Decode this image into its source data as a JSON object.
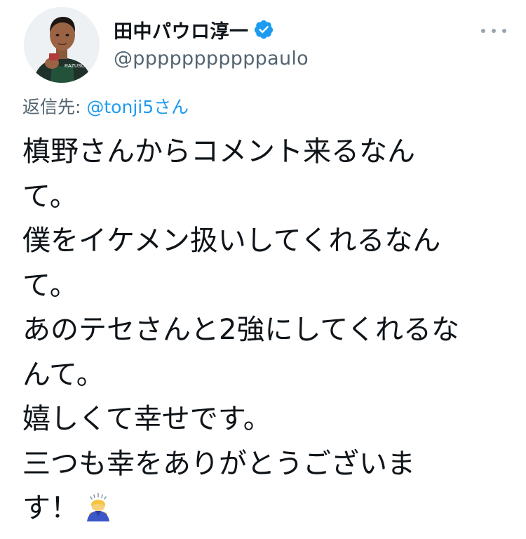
{
  "author": {
    "display_name": "田中パウロ淳一",
    "handle": "@pppppppppppaulo",
    "verified": true,
    "avatar_jersey_text": "RAZUSO"
  },
  "menu": {
    "icon": "more-horizontal-icon"
  },
  "reply": {
    "prefix": "返信先: ",
    "mention": "@tonji5さん"
  },
  "tweet": {
    "lines": [
      "槙野さんからコメント来るなん",
      "て。",
      "僕をイケメン扱いしてくれるなん",
      "て。",
      "あのテセさんと2強にしてくれるな",
      "んて。",
      "嬉しくて幸せです。",
      "三つも幸をありがとうございま",
      "す！"
    ],
    "emoji": "person-bowing-emoji"
  },
  "colors": {
    "text": "#0f1419",
    "secondary": "#536471",
    "link": "#1d9bf0",
    "verified": "#1d9bf0"
  }
}
